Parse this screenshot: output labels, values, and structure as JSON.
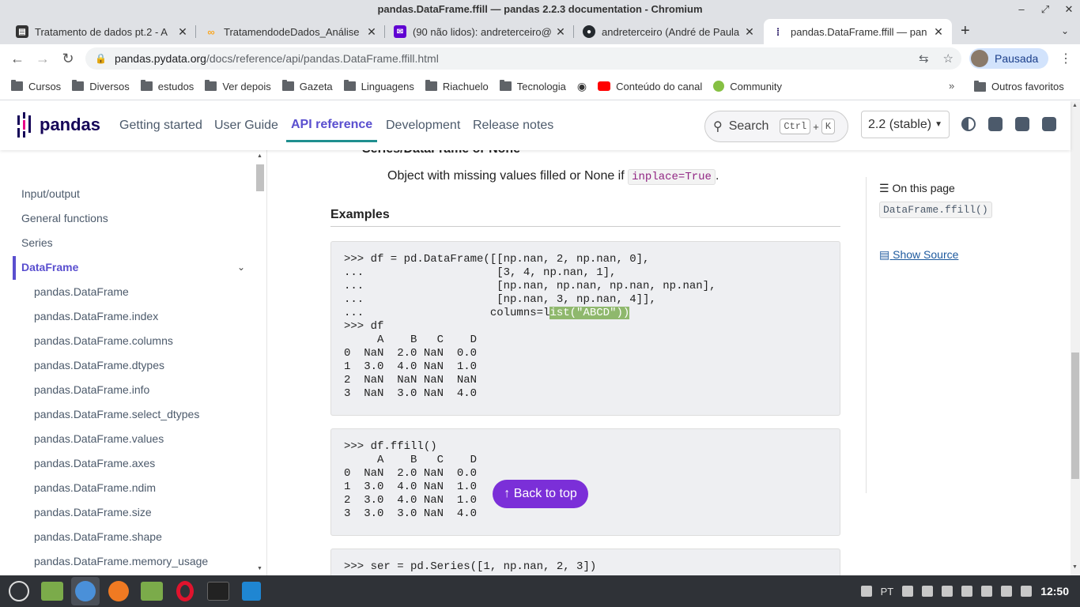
{
  "window": {
    "title": "pandas.DataFrame.ffill — pandas 2.2.3 documentation - Chromium",
    "minimize": "–",
    "restore": "⤢",
    "close": "✕"
  },
  "tabs": [
    {
      "title": "Tratamento de dados pt.2 - A",
      "favicon": "doc-icon",
      "color": "#333"
    },
    {
      "title": "TratamendodeDados_Análise",
      "favicon": "colab-icon",
      "color": "#f9a825"
    },
    {
      "title": "(90 não lidos): andreterceiro@",
      "favicon": "mail-icon",
      "color": "#6001d2"
    },
    {
      "title": "andreterceiro (André de Paula",
      "favicon": "github-icon",
      "color": "#24292e"
    },
    {
      "title": "pandas.DataFrame.ffill — pan",
      "favicon": "pandas-icon",
      "color": "#150458"
    }
  ],
  "toolbar": {
    "url_domain": "pandas.pydata.org",
    "url_path": "/docs/reference/api/pandas.DataFrame.ffill.html",
    "profile_label": "Pausada"
  },
  "bookmarks": [
    "Cursos",
    "Diversos",
    "estudos",
    "Ver depois",
    "Gazeta",
    "Linguagens",
    "Riachuelo",
    "Tecnologia",
    "Conteúdo do canal",
    "Community"
  ],
  "bookmarks_more": "»",
  "bookmarks_other": "Outros favoritos",
  "site_nav": {
    "logo_text": "pandas",
    "links": [
      "Getting started",
      "User Guide",
      "API reference",
      "Development",
      "Release notes"
    ],
    "active_link": "API reference",
    "search_label": "Search",
    "search_kbd_1": "Ctrl",
    "search_kbd_plus": "+",
    "search_kbd_2": "K",
    "version": "2.2 (stable)"
  },
  "sidebar": {
    "sections": [
      "Input/output",
      "General functions",
      "Series",
      "DataFrame"
    ],
    "active_section": "DataFrame",
    "subitems": [
      "pandas.DataFrame",
      "pandas.DataFrame.index",
      "pandas.DataFrame.columns",
      "pandas.DataFrame.dtypes",
      "pandas.DataFrame.info",
      "pandas.DataFrame.select_dtypes",
      "pandas.DataFrame.values",
      "pandas.DataFrame.axes",
      "pandas.DataFrame.ndim",
      "pandas.DataFrame.size",
      "pandas.DataFrame.shape",
      "pandas.DataFrame.memory_usage"
    ]
  },
  "content": {
    "returns_clipped": "Series/DataFrame or None",
    "returns_desc_pre": "Object with missing values filled or None if ",
    "returns_code": "inplace=True",
    "returns_desc_post": ".",
    "examples_heading": "Examples",
    "code_block_1_a": ">>> df = pd.DataFrame([[np.nan, 2, np.nan, 0],\n...                    [3, 4, np.nan, 1],\n...                    [np.nan, np.nan, np.nan, np.nan],\n...                    [np.nan, 3, np.nan, 4]],\n...                   columns=l",
    "code_block_1_hl": "ist(\"ABCD\"))",
    "code_block_1_b": "\n>>> df\n     A    B   C    D\n0  NaN  2.0 NaN  0.0\n1  3.0  4.0 NaN  1.0\n2  NaN  NaN NaN  NaN\n3  NaN  3.0 NaN  4.0",
    "code_block_2": ">>> df.ffill()\n     A    B   C    D\n0  NaN  2.0 NaN  0.0\n1  3.0  4.0 NaN  1.0\n2  3.0  4.0 NaN  1.0\n3  3.0  3.0 NaN  4.0",
    "code_block_3": ">>> ser = pd.Series([1, np.nan, 2, 3])",
    "back_to_top": "↑ Back to top"
  },
  "toc": {
    "title": "On this page",
    "item": "DataFrame.ffill()",
    "show_source": "Show Source"
  },
  "taskbar": {
    "apps": [
      "menu-icon",
      "files-icon",
      "chromium-icon",
      "firefox-icon",
      "files-icon",
      "opera-icon",
      "terminal-icon",
      "vscode-icon"
    ],
    "lang": "PT",
    "clock": "12:50"
  },
  "colors": {
    "pandas_purple": "#5a4fcf",
    "back_to_top": "#7b2fd8",
    "accent_teal": "#1f8f8f"
  }
}
